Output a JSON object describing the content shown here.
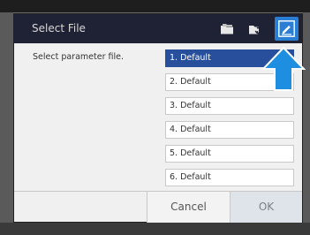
{
  "dialog": {
    "title": "Select File",
    "prompt": "Select parameter file.",
    "files": [
      {
        "label": "1. Default",
        "selected": true
      },
      {
        "label": "2. Default",
        "selected": false
      },
      {
        "label": "3. Default",
        "selected": false
      },
      {
        "label": "4. Default",
        "selected": false
      },
      {
        "label": "5. Default",
        "selected": false
      },
      {
        "label": "6. Default",
        "selected": false
      }
    ],
    "cancel_label": "Cancel",
    "ok_label": "OK"
  },
  "icons": {
    "toolbar": [
      "folder-icon",
      "folder-sync-icon",
      "edit-icon"
    ],
    "annotation": "arrow-up-icon"
  },
  "colors": {
    "titlebar": "#1f2235",
    "selected_item": "#274f9c",
    "edit_button": "#2a7fd4",
    "arrow": "#1e8fe0"
  }
}
